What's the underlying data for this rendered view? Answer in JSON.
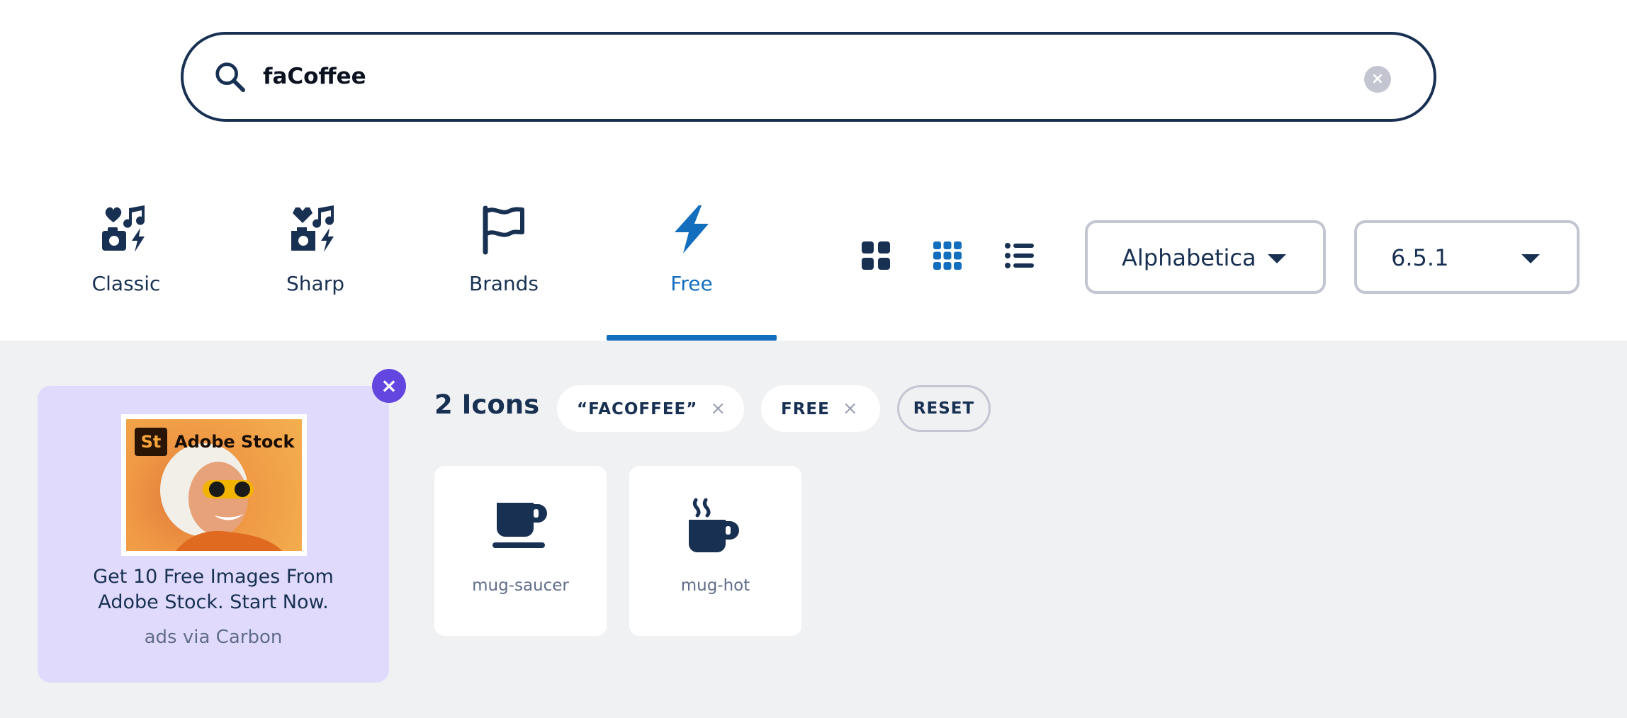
{
  "search": {
    "value": "faCoffee",
    "clear_label": "×",
    "search_icon": "magnifying-glass-icon"
  },
  "family_tabs": [
    {
      "label": "Classic",
      "icon": "classic-family-icon",
      "active": false
    },
    {
      "label": "Sharp",
      "icon": "sharp-family-icon",
      "active": false
    },
    {
      "label": "Brands",
      "icon": "flag-icon",
      "active": false
    },
    {
      "label": "Free",
      "icon": "bolt-icon",
      "active": true
    }
  ],
  "view_modes": [
    {
      "icon": "large-grid-icon",
      "active": false
    },
    {
      "icon": "small-grid-icon",
      "active": true
    },
    {
      "icon": "list-icon",
      "active": false
    }
  ],
  "sort_select": {
    "value": "Alphabetical"
  },
  "version_select": {
    "value": "6.5.1"
  },
  "ad": {
    "brand": "Adobe Stock",
    "brand_badge": "St",
    "text_line1": "Get 10 Free Images From",
    "text_line2": "Adobe Stock. Start Now.",
    "via": "ads via Carbon",
    "close_label": "×"
  },
  "results": {
    "count": "2 Icons",
    "filters": [
      {
        "label": "“FACOFFEE”",
        "remove": "×"
      },
      {
        "label": "FREE",
        "remove": "×"
      }
    ],
    "reset_label": "RESET"
  },
  "icons": [
    {
      "name": "mug-saucer",
      "icon": "mug-saucer-icon"
    },
    {
      "name": "mug-hot",
      "icon": "mug-hot-icon"
    }
  ],
  "colors": {
    "navy": "#183153",
    "accent_blue": "#146ebe",
    "background_gray": "#f0f1f3",
    "ad_purple": "#e0dafc",
    "close_purple": "#6346e0"
  }
}
